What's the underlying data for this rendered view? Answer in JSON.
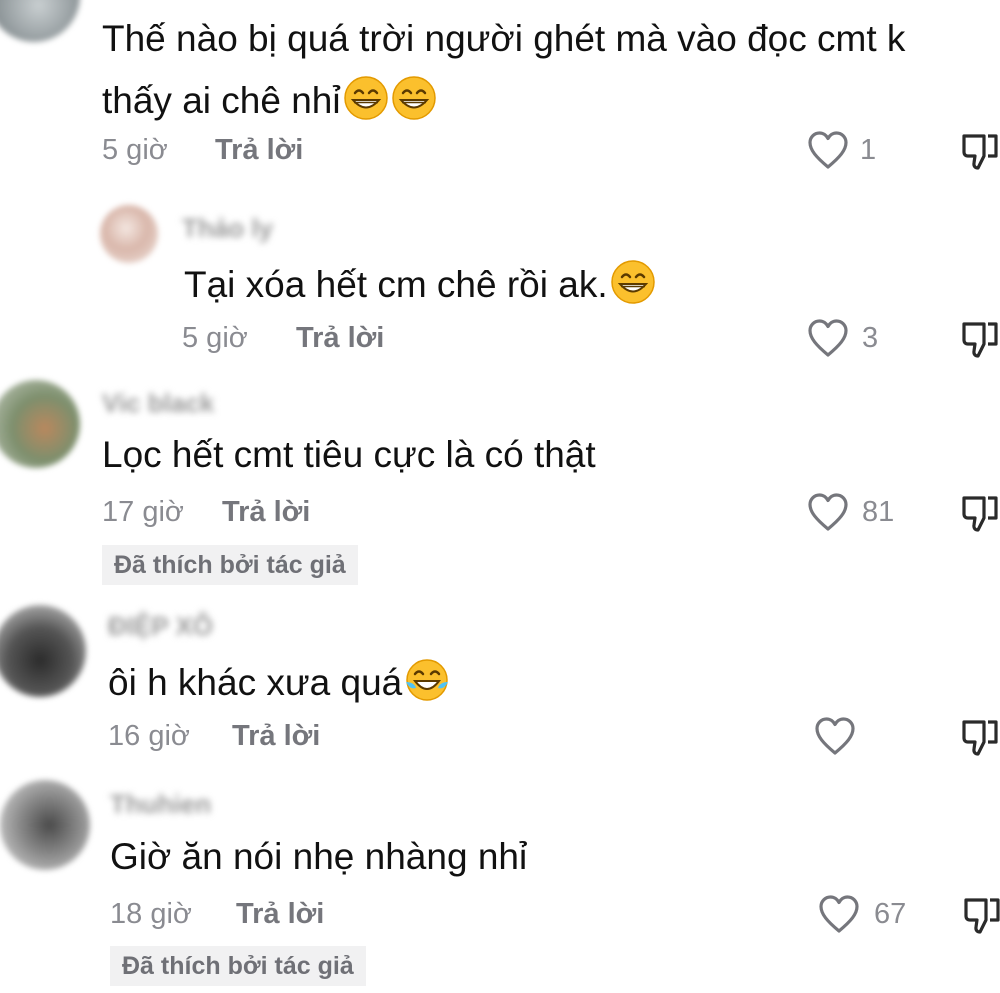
{
  "comments": [
    {
      "text": "Thế nào bị quá trời người ghét mà vào đọc cmt k thấy ai chê nhỉ",
      "emojis": [
        "grin-emoji",
        "grin-emoji"
      ],
      "time": "5 giờ",
      "reply": "Trả lời",
      "likes": "1"
    },
    {
      "username": "Thảo ly",
      "text": "Tại xóa hết cm chê rồi ak.",
      "emojis": [
        "grin-emoji"
      ],
      "time": "5 giờ",
      "reply": "Trả lời",
      "likes": "3"
    },
    {
      "username": "Vic black",
      "text": "Lọc hết cmt tiêu cực là có thật",
      "time": "17 giờ",
      "reply": "Trả lời",
      "likes": "81",
      "badge": "Đã thích bởi tác giả"
    },
    {
      "username": "ĐIỆP XÔ",
      "text": "ôi h khác xưa quá",
      "emojis": [
        "tears-of-joy-emoji"
      ],
      "time": "16 giờ",
      "reply": "Trả lời",
      "likes": ""
    },
    {
      "username": "Thuhien",
      "text": "Giờ ăn nói nhẹ nhàng nhỉ",
      "time": "18 giờ",
      "reply": "Trả lời",
      "likes": "67",
      "badge": "Đã thích bởi tác giả"
    }
  ],
  "colors": {
    "text": "#161823",
    "meta": "#8a8b91",
    "badge_bg": "#f1f1f2",
    "emoji": "#fbc02d"
  },
  "icons": [
    "heart-outline-icon",
    "dislike-thumb-icon"
  ]
}
